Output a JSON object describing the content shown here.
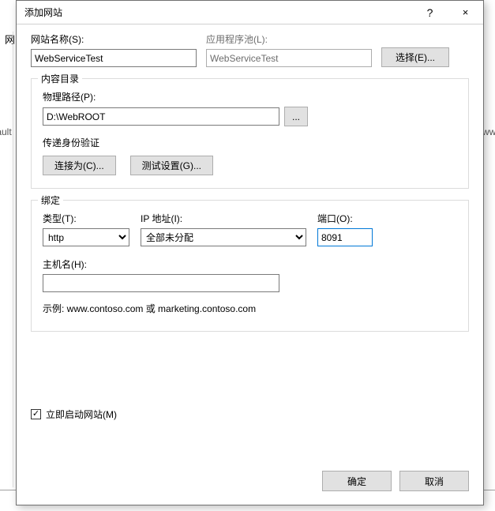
{
  "backdrop": {
    "left_text": "fault",
    "right_text": "wwro",
    "left_title_fragment": "网"
  },
  "dialog": {
    "title": "添加网站",
    "help_glyph": "?",
    "close_glyph": "×"
  },
  "site_name": {
    "label": "网站名称(S):",
    "value": "WebServiceTest"
  },
  "app_pool": {
    "label": "应用程序池(L):",
    "value": "WebServiceTest",
    "select_button": "选择(E)..."
  },
  "content": {
    "legend": "内容目录",
    "physical_path_label": "物理路径(P):",
    "physical_path_value": "D:\\WebROOT",
    "browse_glyph": "...",
    "passthrough_label": "传递身份验证",
    "connect_as_button": "连接为(C)...",
    "test_settings_button": "测试设置(G)..."
  },
  "binding": {
    "legend": "绑定",
    "type_label": "类型(T):",
    "type_value": "http",
    "ip_label": "IP 地址(I):",
    "ip_value": "全部未分配",
    "port_label": "端口(O):",
    "port_value": "8091",
    "hostname_label": "主机名(H):",
    "hostname_value": "",
    "example": "示例: www.contoso.com 或 marketing.contoso.com"
  },
  "autostart": {
    "label": "立即启动网站(M)",
    "checked_glyph": "✓"
  },
  "footer": {
    "ok": "确定",
    "cancel": "取消"
  }
}
